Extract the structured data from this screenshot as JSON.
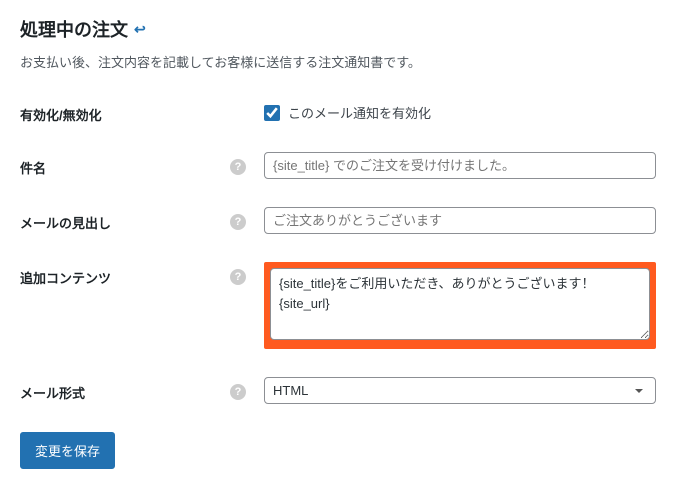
{
  "header": {
    "title": "処理中の注文",
    "back_icon_name": "back-icon"
  },
  "description": "お支払い後、注文内容を記載してお客様に送信する注文通知書です。",
  "fields": {
    "enable": {
      "label": "有効化/無効化",
      "checkbox_label": "このメール通知を有効化",
      "checked": true
    },
    "subject": {
      "label": "件名",
      "placeholder": "{site_title} でのご注文を受け付けました。",
      "value": ""
    },
    "heading": {
      "label": "メールの見出し",
      "placeholder": "ご注文ありがとうございます",
      "value": ""
    },
    "additional": {
      "label": "追加コンテンツ",
      "value": "{site_title}をご利用いただき、ありがとうございます！\n{site_url}"
    },
    "format": {
      "label": "メール形式",
      "selected": "HTML"
    }
  },
  "buttons": {
    "save": "変更を保存"
  },
  "help_glyph": "?"
}
